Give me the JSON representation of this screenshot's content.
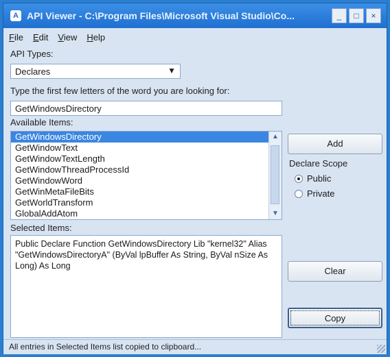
{
  "window": {
    "title": "API Viewer - C:\\Program Files\\Microsoft Visual Studio\\Co...",
    "buttons": {
      "minimize": "_",
      "maximize": "□",
      "close": "×"
    }
  },
  "menu": [
    "File",
    "Edit",
    "View",
    "Help"
  ],
  "api_types": {
    "label": "API Types:",
    "selected": "Declares"
  },
  "search": {
    "label": "Type the first few letters of the word you are looking for:",
    "value": "GetWindowsDirectory"
  },
  "available_items": {
    "label": "Available Items:",
    "items": [
      "GetWindowsDirectory",
      "GetWindowText",
      "GetWindowTextLength",
      "GetWindowThreadProcessId",
      "GetWindowWord",
      "GetWinMetaFileBits",
      "GetWorldTransform",
      "GlobalAddAtom"
    ],
    "selected_index": 0
  },
  "selected_items": {
    "label": "Selected Items:",
    "text": "Public Declare Function GetWindowsDirectory Lib \"kernel32\" Alias \"GetWindowsDirectoryA\" (ByVal lpBuffer As String, ByVal nSize As Long) As Long"
  },
  "buttons": {
    "add": "Add",
    "clear": "Clear",
    "copy": "Copy"
  },
  "declare_scope": {
    "label": "Declare Scope",
    "options": [
      "Public",
      "Private"
    ],
    "selected": "Public"
  },
  "status": {
    "text": "All entries in Selected Items list copied to clipboard..."
  }
}
